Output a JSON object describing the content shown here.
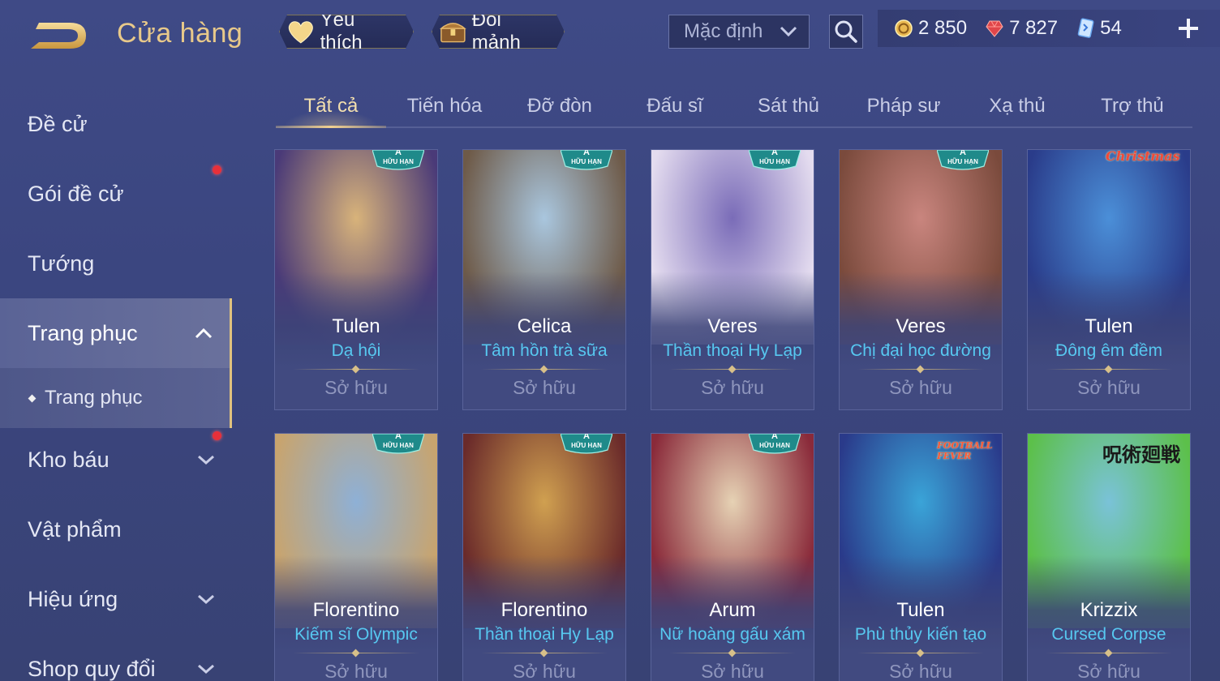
{
  "header": {
    "title": "Cửa hàng",
    "favorites_label": "Yêu thích",
    "exchange_label": "Đổi mảnh",
    "sort": {
      "selected": "Mặc định"
    },
    "currencies": [
      {
        "icon": "gold-coin-icon",
        "value": "2 850"
      },
      {
        "icon": "ruby-gem-icon",
        "value": "7 827"
      },
      {
        "icon": "voucher-card-icon",
        "value": "54"
      }
    ]
  },
  "sidebar": {
    "items": [
      {
        "label": "Đề cử"
      },
      {
        "label": "Gói đề cử",
        "notification": true
      },
      {
        "label": "Tướng"
      },
      {
        "label": "Trang phục",
        "expanded": true
      },
      {
        "label": "Trang phục",
        "sub": true
      },
      {
        "label": "Kho báu",
        "notification": true
      },
      {
        "label": "Vật phẩm"
      },
      {
        "label": "Hiệu ứng"
      },
      {
        "label": "Shop quy đổi"
      }
    ]
  },
  "tabs": [
    {
      "label": "Tất cả",
      "active": true
    },
    {
      "label": "Tiến hóa"
    },
    {
      "label": "Đỡ đòn"
    },
    {
      "label": "Đấu sĩ"
    },
    {
      "label": "Sát thủ"
    },
    {
      "label": "Pháp sư"
    },
    {
      "label": "Xạ thủ"
    },
    {
      "label": "Trợ thủ"
    }
  ],
  "badge": {
    "grade": "A",
    "limited": "HỮU HẠN"
  },
  "cards": [
    {
      "hero": "Tulen",
      "skin": "Dạ hội",
      "status": "Sở hữu",
      "badge": true,
      "colors": [
        "#d8b37a",
        "#4a3a78"
      ]
    },
    {
      "hero": "Celica",
      "skin": "Tâm hồn trà sữa",
      "status": "Sở hữu",
      "badge": true,
      "colors": [
        "#a9c6de",
        "#6e5a48"
      ]
    },
    {
      "hero": "Veres",
      "skin": "Thần thoại Hy Lạp",
      "status": "Sở hữu",
      "badge": true,
      "colors": [
        "#7a6cb8",
        "#e4dcef"
      ]
    },
    {
      "hero": "Veres",
      "skin": "Chị đại học đường",
      "status": "Sở hữu",
      "badge": true,
      "colors": [
        "#c9857e",
        "#7a4a3c"
      ]
    },
    {
      "hero": "Tulen",
      "skin": "Đông êm đềm",
      "status": "Sở hữu",
      "badge": false,
      "event": "Christmas",
      "colors": [
        "#4b8fd8",
        "#2a3c8a"
      ]
    },
    {
      "hero": "Florentino",
      "skin": "Kiếm sĩ Olympic",
      "status": "Sở hữu",
      "badge": true,
      "colors": [
        "#8eb0d6",
        "#c8a46e"
      ]
    },
    {
      "hero": "Florentino",
      "skin": "Thần thoại Hy Lạp",
      "status": "Sở hữu",
      "badge": true,
      "colors": [
        "#d0a050",
        "#6a2a2a"
      ]
    },
    {
      "hero": "Arum",
      "skin": "Nữ hoàng gấu xám",
      "status": "Sở hữu",
      "badge": true,
      "colors": [
        "#e6d2b4",
        "#8a2a3a"
      ]
    },
    {
      "hero": "Tulen",
      "skin": "Phù thủy kiến tạo",
      "status": "Sở hữu",
      "badge": false,
      "event": "FOOTBALL FEVER",
      "colors": [
        "#3aa4d8",
        "#2a3a8a"
      ]
    },
    {
      "hero": "Krizzix",
      "skin": "Cursed Corpse",
      "status": "Sở hữu",
      "badge": false,
      "event": "呪術廻戦",
      "colors": [
        "#7ac2d8",
        "#5cc04a"
      ]
    }
  ]
}
